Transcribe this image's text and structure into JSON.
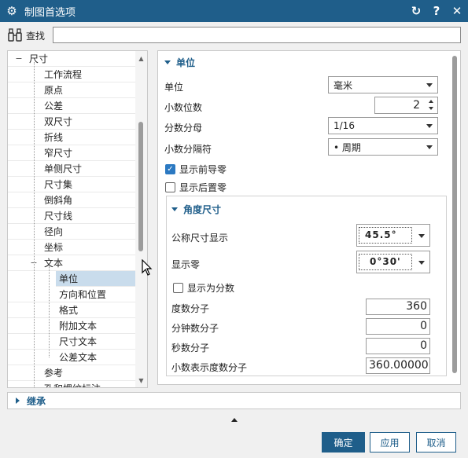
{
  "window": {
    "title": "制图首选项",
    "controls": [
      "reset-icon",
      "help-icon",
      "close-icon"
    ]
  },
  "search": {
    "label": "查找",
    "value": "",
    "placeholder": ""
  },
  "tree": {
    "items": [
      {
        "label": "尺寸",
        "level": 0,
        "expanded": true
      },
      {
        "label": "工作流程",
        "level": 1
      },
      {
        "label": "原点",
        "level": 1
      },
      {
        "label": "公差",
        "level": 1
      },
      {
        "label": "双尺寸",
        "level": 1
      },
      {
        "label": "折线",
        "level": 1
      },
      {
        "label": "窄尺寸",
        "level": 1
      },
      {
        "label": "单侧尺寸",
        "level": 1
      },
      {
        "label": "尺寸集",
        "level": 1
      },
      {
        "label": "倒斜角",
        "level": 1
      },
      {
        "label": "尺寸线",
        "level": 1
      },
      {
        "label": "径向",
        "level": 1
      },
      {
        "label": "坐标",
        "level": 1
      },
      {
        "label": "文本",
        "level": 1,
        "expanded": true
      },
      {
        "label": "单位",
        "level": 2,
        "selected": true
      },
      {
        "label": "方向和位置",
        "level": 2
      },
      {
        "label": "格式",
        "level": 2
      },
      {
        "label": "附加文本",
        "level": 2
      },
      {
        "label": "尺寸文本",
        "level": 2
      },
      {
        "label": "公差文本",
        "level": 2
      },
      {
        "label": "参考",
        "level": 1
      },
      {
        "label": "孔和螺纹标注",
        "level": 1
      }
    ]
  },
  "units_section": {
    "title": "单位",
    "unit_label": "单位",
    "unit_value": "毫米",
    "decimals_label": "小数位数",
    "decimals_value": "2",
    "fraction_denom_label": "分数分母",
    "fraction_denom_value": "1/16",
    "decimal_sep_label": "小数分隔符",
    "decimal_sep_value": "• 周期",
    "show_leading_zeros_label": "显示前导零",
    "show_leading_zeros_checked": true,
    "show_trailing_zeros_label": "显示后置零",
    "show_trailing_zeros_checked": false
  },
  "angle_section": {
    "title": "角度尺寸",
    "nominal_display_label": "公称尺寸显示",
    "nominal_display_value": "45.5°",
    "show_zero_label": "显示零",
    "show_zero_value": "0°30'",
    "show_as_fraction_label": "显示为分数",
    "show_as_fraction_checked": false,
    "degree_numerator_label": "度数分子",
    "degree_numerator_value": "360",
    "minute_numerator_label": "分钟数分子",
    "minute_numerator_value": "0",
    "second_numerator_label": "秒数分子",
    "second_numerator_value": "0",
    "decimal_degree_numerator_label": "小数表示度数分子",
    "decimal_degree_numerator_value": "360.00000"
  },
  "inherit": {
    "label": "继承"
  },
  "buttons": {
    "ok": "确定",
    "apply": "应用",
    "cancel": "取消"
  },
  "colors": {
    "accent": "#1f5e8a",
    "selected_row": "#c9dcec",
    "checkbox": "#2b79c2"
  }
}
